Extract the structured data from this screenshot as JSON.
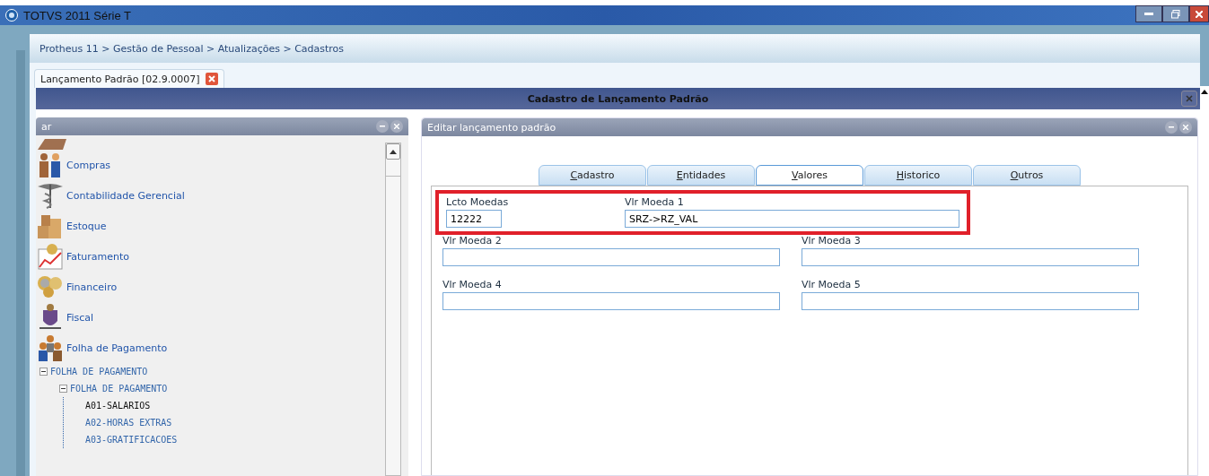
{
  "window": {
    "title": "TOTVS 2011 Série T"
  },
  "breadcrumb": "Protheus 11 > Gestão de Pessoal > Atualizações > Cadastros",
  "doc_tabs": [
    {
      "label": "Lançamento Padrão [02.9.0007]",
      "selected": true
    }
  ],
  "dialog": {
    "title": "Cadastro de Lançamento Padrão"
  },
  "side_panel": {
    "title": "ar",
    "modules": [
      {
        "label": "Compras",
        "kind": "people"
      },
      {
        "label": "Contabilidade Gerencial",
        "kind": "caduceus"
      },
      {
        "label": "Estoque",
        "kind": "boxes"
      },
      {
        "label": "Faturamento",
        "kind": "chart"
      },
      {
        "label": "Financeiro",
        "kind": "coins"
      },
      {
        "label": "Fiscal",
        "kind": "crest"
      },
      {
        "label": "Folha de Pagamento",
        "kind": "group"
      }
    ],
    "tree": [
      {
        "label": "FOLHA DE PAGAMENTO",
        "expanded": true,
        "selected": false,
        "children": [
          {
            "label": "FOLHA DE PAGAMENTO",
            "expanded": true,
            "selected": false,
            "children": [
              {
                "label": "A01-SALARIOS",
                "selected": true
              },
              {
                "label": "A02-HORAS EXTRAS",
                "selected": false
              },
              {
                "label": "A03-GRATIFICACOES",
                "selected": false
              }
            ]
          }
        ]
      }
    ]
  },
  "edit_panel": {
    "title": "Editar lançamento padrão",
    "tabs": [
      {
        "label": "Cadastro",
        "selected": false
      },
      {
        "label": "Entidades",
        "selected": false
      },
      {
        "label": "Valores",
        "selected": true
      },
      {
        "label": "Historico",
        "selected": false
      },
      {
        "label": "Outros",
        "selected": false
      }
    ],
    "fields": [
      {
        "label": "Lcto Moedas",
        "value": "12222",
        "kind": "short"
      },
      {
        "label": "Vlr Moeda 1",
        "value": "SRZ->RZ_VAL",
        "kind": "wide"
      },
      {
        "label": "Vlr Moeda 2",
        "kind": "half"
      },
      {
        "label": "Vlr Moeda 3",
        "kind": "half"
      },
      {
        "label": "Vlr Moeda 4",
        "kind": "half"
      },
      {
        "label": "Vlr Moeda 5",
        "kind": "half"
      }
    ]
  }
}
